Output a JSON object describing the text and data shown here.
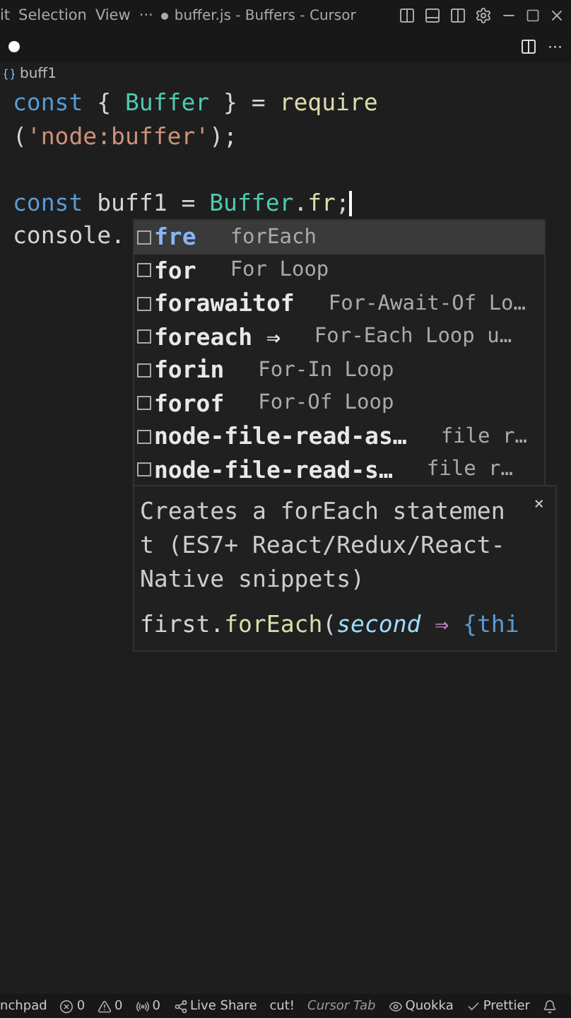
{
  "menu": [
    "it",
    "Selection",
    "View",
    "···"
  ],
  "window": {
    "title": "buffer.js - Buffers - Cursor",
    "modified": true
  },
  "tab": {
    "modified": true,
    "more": "···"
  },
  "breadcrumb": {
    "label": "buff1"
  },
  "code": [
    {
      "tokens": [
        {
          "t": "const",
          "kind": "keyword"
        },
        {
          "t": " { ",
          "kind": "plain"
        },
        {
          "t": "Buffer",
          "kind": "class"
        },
        {
          "t": " } = ",
          "kind": "plain"
        },
        {
          "t": "require",
          "kind": "func"
        }
      ]
    },
    {
      "tokens": [
        {
          "t": "(",
          "kind": "plain"
        },
        {
          "t": "'node:buffer'",
          "kind": "string"
        },
        {
          "t": ");",
          "kind": "plain"
        }
      ]
    },
    {
      "blank": true
    },
    {
      "tokens": [
        {
          "t": "const",
          "kind": "keyword"
        },
        {
          "t": " buff1 = ",
          "kind": "plain"
        },
        {
          "t": "Buffer",
          "kind": "class"
        },
        {
          "t": ".",
          "kind": "plain"
        },
        {
          "t": "fr",
          "kind": "func"
        },
        {
          "t": ";",
          "kind": "plain",
          "cursor": true
        }
      ]
    },
    {
      "tokens": [
        {
          "t": "console.",
          "kind": "plain"
        }
      ]
    }
  ],
  "suggestions": [
    {
      "label": "fre",
      "detail": "forEach",
      "selected": true
    },
    {
      "label": "for",
      "detail": "For Loop",
      "selected": false
    },
    {
      "label": "forawaitof",
      "detail": "For-Await-Of Lo…",
      "selected": false
    },
    {
      "label": "foreach ⇒",
      "detail": "For-Each Loop u…",
      "selected": false
    },
    {
      "label": "forin",
      "detail": "For-In Loop",
      "selected": false
    },
    {
      "label": "forof",
      "detail": "For-Of Loop",
      "selected": false
    },
    {
      "label": "node-file-read-as…",
      "detail": "file r…",
      "selected": false
    },
    {
      "label": "node-file-read-s…",
      "detail": "file r…",
      "selected": false
    }
  ],
  "details": {
    "description": "Creates a forEach statement (ES7+ React/Redux/React-Native snippets)",
    "close": "×",
    "snippet": [
      {
        "t": "first.",
        "kind": "plain"
      },
      {
        "t": "forEach",
        "kind": "func"
      },
      {
        "t": "(",
        "kind": "plain"
      },
      {
        "t": "second",
        "kind": "param"
      },
      {
        "t": " ⇒ ",
        "kind": "arrow"
      },
      {
        "t": "{thi",
        "kind": "keyword"
      }
    ]
  },
  "status_bar": [
    {
      "kind": "text",
      "label": "nchpad"
    },
    {
      "kind": "errors",
      "label": "0"
    },
    {
      "kind": "warnings",
      "label": "0"
    },
    {
      "kind": "ports",
      "label": "0"
    },
    {
      "kind": "share",
      "label": "Live Share"
    },
    {
      "kind": "text",
      "label": "cut!"
    },
    {
      "kind": "text",
      "label": "Cursor Tab",
      "disabled": true
    },
    {
      "kind": "eye",
      "label": "Quokka"
    },
    {
      "kind": "check",
      "label": "Prettier"
    },
    {
      "kind": "bell"
    }
  ]
}
